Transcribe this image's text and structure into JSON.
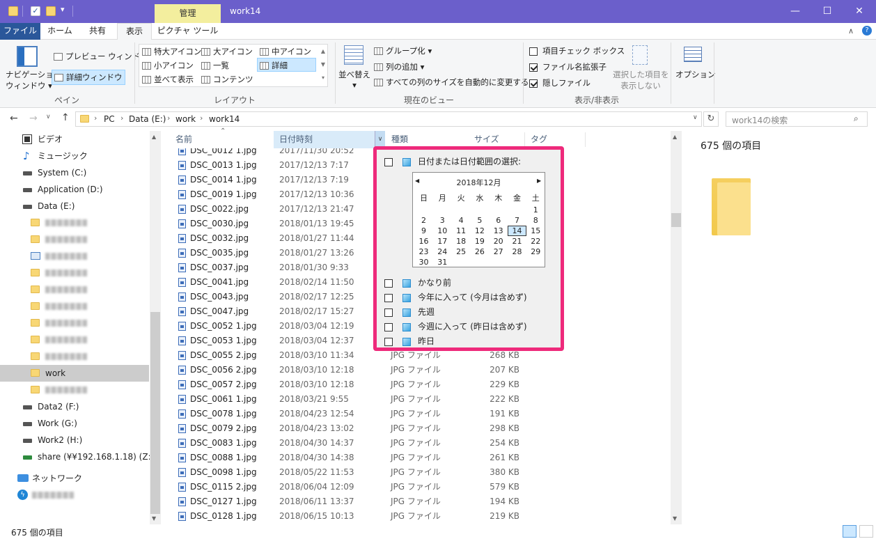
{
  "titlebar": {
    "context_tab": "管理",
    "window_title": "work14",
    "minimize": "—",
    "maximize": "☐",
    "close": "✕"
  },
  "ribbon_tabs": {
    "file": "ファイル",
    "home": "ホーム",
    "share": "共有",
    "view": "表示",
    "picture_tools": "ピクチャ ツール"
  },
  "ribbon": {
    "pane": {
      "nav_pane": "ナビゲーション\nウィンドウ",
      "nav_pane_l1": "ナビゲーション",
      "nav_pane_l2": "ウィンドウ ▾",
      "preview": "プレビュー ウィンドウ",
      "details": "詳細ウィンドウ",
      "label": "ペイン"
    },
    "layout": {
      "items": [
        "特大アイコン",
        "大アイコン",
        "中アイコン",
        "小アイコン",
        "一覧",
        "詳細",
        "並べて表示",
        "コンテンツ"
      ],
      "label": "レイアウト"
    },
    "current_view": {
      "sort": "並べ替え",
      "group": "グループ化 ▾",
      "add_col": "列の追加 ▾",
      "autosize": "すべての列のサイズを自動的に変更する",
      "label": "現在のビュー"
    },
    "show_hide": {
      "item_checkbox": "項目チェック ボックス",
      "extensions": "ファイル名拡張子",
      "hidden": "隠しファイル",
      "hide_selected_l1": "選択した項目を",
      "hide_selected_l2": "表示しない",
      "label": "表示/非表示"
    },
    "options": "オプション"
  },
  "address": {
    "crumbs": [
      "PC",
      "Data (E:)",
      "work",
      "work14"
    ],
    "search_placeholder": "work14の検索"
  },
  "nav": [
    {
      "label": "ビデオ",
      "kind": "video"
    },
    {
      "label": "ミュージック",
      "kind": "music"
    },
    {
      "label": "System (C:)",
      "kind": "drive"
    },
    {
      "label": "Application (D:)",
      "kind": "drive"
    },
    {
      "label": "Data (E:)",
      "kind": "drive"
    },
    {
      "label": "",
      "kind": "folder"
    },
    {
      "label": "",
      "kind": "folder"
    },
    {
      "label": "",
      "kind": "special"
    },
    {
      "label": "",
      "kind": "folder"
    },
    {
      "label": "",
      "kind": "folder"
    },
    {
      "label": "",
      "kind": "folder"
    },
    {
      "label": "",
      "kind": "folder"
    },
    {
      "label": "",
      "kind": "folder"
    },
    {
      "label": "",
      "kind": "folder"
    },
    {
      "label": "work",
      "kind": "folder",
      "selected": true
    },
    {
      "label": "",
      "kind": "folder"
    },
    {
      "label": "Data2 (F:)",
      "kind": "drive"
    },
    {
      "label": "Work (G:)",
      "kind": "drive"
    },
    {
      "label": "Work2 (H:)",
      "kind": "drive"
    },
    {
      "label": "share (¥¥192.168.1.18) (Z:)",
      "kind": "netdrive"
    },
    {
      "label": "ネットワーク",
      "kind": "network"
    },
    {
      "label": "",
      "kind": "other"
    }
  ],
  "columns": {
    "name": "名前",
    "date": "日付時刻",
    "type": "種類",
    "size": "サイズ",
    "tag": "タグ"
  },
  "files": [
    {
      "name": "DSC_0012 1.jpg",
      "date": "2017/11/30 20:52",
      "type": "",
      "size": ""
    },
    {
      "name": "DSC_0013 1.jpg",
      "date": "2017/12/13 7:17",
      "type": "",
      "size": ""
    },
    {
      "name": "DSC_0014 1.jpg",
      "date": "2017/12/13 7:19",
      "type": "",
      "size": ""
    },
    {
      "name": "DSC_0019 1.jpg",
      "date": "2017/12/13 10:36",
      "type": "",
      "size": ""
    },
    {
      "name": "DSC_0022.jpg",
      "date": "2017/12/13 21:47",
      "type": "",
      "size": ""
    },
    {
      "name": "DSC_0030.jpg",
      "date": "2018/01/13 19:45",
      "type": "",
      "size": ""
    },
    {
      "name": "DSC_0032.jpg",
      "date": "2018/01/27 11:44",
      "type": "",
      "size": ""
    },
    {
      "name": "DSC_0035.jpg",
      "date": "2018/01/27 13:26",
      "type": "",
      "size": ""
    },
    {
      "name": "DSC_0037.jpg",
      "date": "2018/01/30 9:33",
      "type": "",
      "size": ""
    },
    {
      "name": "DSC_0041.jpg",
      "date": "2018/02/14 11:50",
      "type": "",
      "size": ""
    },
    {
      "name": "DSC_0043.jpg",
      "date": "2018/02/17 12:25",
      "type": "",
      "size": ""
    },
    {
      "name": "DSC_0047.jpg",
      "date": "2018/02/17 15:27",
      "type": "",
      "size": ""
    },
    {
      "name": "DSC_0052 1.jpg",
      "date": "2018/03/04 12:19",
      "type": "",
      "size": ""
    },
    {
      "name": "DSC_0053 1.jpg",
      "date": "2018/03/04 12:37",
      "type": "",
      "size": ""
    },
    {
      "name": "DSC_0055 2.jpg",
      "date": "2018/03/10 11:34",
      "type": "JPG ファイル",
      "size": "268 KB"
    },
    {
      "name": "DSC_0056 2.jpg",
      "date": "2018/03/10 12:18",
      "type": "JPG ファイル",
      "size": "207 KB"
    },
    {
      "name": "DSC_0057 2.jpg",
      "date": "2018/03/10 12:18",
      "type": "JPG ファイル",
      "size": "229 KB"
    },
    {
      "name": "DSC_0061 1.jpg",
      "date": "2018/03/21 9:55",
      "type": "JPG ファイル",
      "size": "222 KB"
    },
    {
      "name": "DSC_0078 1.jpg",
      "date": "2018/04/23 12:54",
      "type": "JPG ファイル",
      "size": "191 KB"
    },
    {
      "name": "DSC_0079 2.jpg",
      "date": "2018/04/23 13:02",
      "type": "JPG ファイル",
      "size": "298 KB"
    },
    {
      "name": "DSC_0083 1.jpg",
      "date": "2018/04/30 14:37",
      "type": "JPG ファイル",
      "size": "254 KB"
    },
    {
      "name": "DSC_0088 1.jpg",
      "date": "2018/04/30 14:38",
      "type": "JPG ファイル",
      "size": "261 KB"
    },
    {
      "name": "DSC_0098 1.jpg",
      "date": "2018/05/22 11:53",
      "type": "JPG ファイル",
      "size": "380 KB"
    },
    {
      "name": "DSC_0115 2.jpg",
      "date": "2018/06/04 12:09",
      "type": "JPG ファイル",
      "size": "579 KB"
    },
    {
      "name": "DSC_0127 1.jpg",
      "date": "2018/06/11 13:37",
      "type": "JPG ファイル",
      "size": "194 KB"
    },
    {
      "name": "DSC_0128 1.jpg",
      "date": "2018/06/15 10:13",
      "type": "JPG ファイル",
      "size": "219 KB"
    }
  ],
  "filter_popup": {
    "select_range": "日付または日付範囲の選択:",
    "month_title": "2018年12月",
    "weekdays": [
      "日",
      "月",
      "火",
      "水",
      "木",
      "金",
      "土"
    ],
    "days": [
      "",
      "",
      "",
      "",
      "",
      "",
      "1",
      "2",
      "3",
      "4",
      "5",
      "6",
      "7",
      "8",
      "9",
      "10",
      "11",
      "12",
      "13",
      "14",
      "15",
      "16",
      "17",
      "18",
      "19",
      "20",
      "21",
      "22",
      "23",
      "24",
      "25",
      "26",
      "27",
      "28",
      "29",
      "30",
      "31"
    ],
    "today": "14",
    "options": [
      "かなり前",
      "今年に入って (今月は含めず)",
      "先週",
      "今週に入って (昨日は含めず)",
      "昨日"
    ]
  },
  "details_pane": {
    "count": "675 個の項目"
  },
  "status": {
    "count": "675 個の項目"
  },
  "colors": {
    "titlebar": "#6b5fcb",
    "context_tab": "#f3ee9e",
    "file_tab": "#2a579a",
    "popup_border": "#ee2a7b",
    "selection": "#cce8ff"
  }
}
